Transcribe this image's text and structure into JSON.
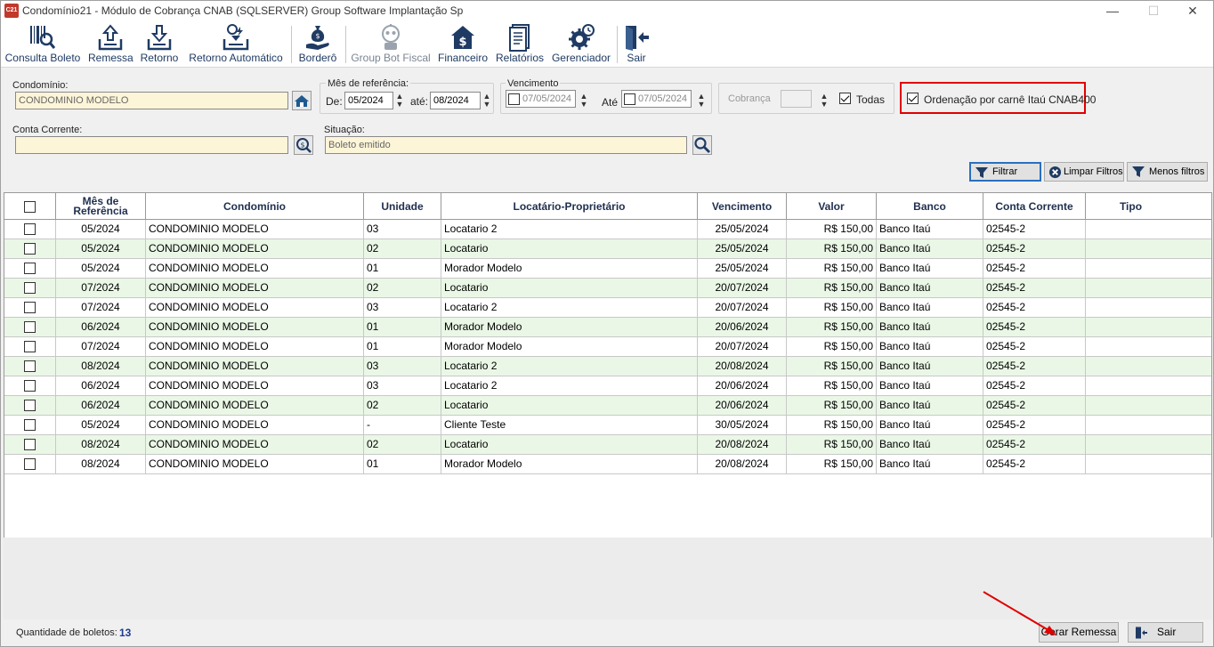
{
  "window": {
    "title": "Condomínio21 - Módulo de Cobrança CNAB (SQLSERVER)  Group Software Implantação Sp",
    "app_icon_text": "C21",
    "minimize": "—",
    "maximize": "☐",
    "close": "✕"
  },
  "toolbar": {
    "consulta_boleto": "Consulta Boleto",
    "remessa": "Remessa",
    "retorno": "Retorno",
    "retorno_automatico": "Retorno Automático",
    "bordero": "Borderô",
    "group_bot_fiscal": "Group Bot Fiscal",
    "financeiro": "Financeiro",
    "relatorios": "Relatórios",
    "gerenciador": "Gerenciador",
    "sair": "Sair"
  },
  "filters": {
    "condominio_label": "Condomínio:",
    "condominio_value": "CONDOMINIO MODELO",
    "mes_ref_label": "Mês de referência:",
    "de_label": "De:",
    "de_value": "05/2024",
    "ate_label": "até:",
    "ate_value": "08/2024",
    "vencimento_label": "Vencimento",
    "venc_de_value": "07/05/2024",
    "venc_ate_label": "Até",
    "venc_ate_value": "07/05/2024",
    "cobranca_label": "Cobrança",
    "todas_label": "Todas",
    "ordenacao_label": "Ordenação por carnê Itaú CNAB400",
    "conta_corrente_label": "Conta Corrente:",
    "conta_corrente_value": "",
    "situacao_label": "Situação:",
    "situacao_value": "Boleto emitido",
    "filtrar": "Filtrar",
    "limpar_filtros": "Limpar Filtros",
    "menos_filtros": "Menos filtros"
  },
  "table": {
    "headers": [
      "Mês de Referência",
      "Condomínio",
      "Unidade",
      "Locatário-Proprietário",
      "Vencimento",
      "Valor",
      "Banco",
      "Conta Corrente",
      "Tipo"
    ],
    "rows": [
      [
        "05/2024",
        "CONDOMINIO MODELO",
        "03",
        "Locatario 2",
        "25/05/2024",
        "R$ 150,00",
        "Banco Itaú",
        "02545-2",
        ""
      ],
      [
        "05/2024",
        "CONDOMINIO MODELO",
        "02",
        "Locatario",
        "25/05/2024",
        "R$ 150,00",
        "Banco Itaú",
        "02545-2",
        ""
      ],
      [
        "05/2024",
        "CONDOMINIO MODELO",
        "01",
        "Morador Modelo",
        "25/05/2024",
        "R$ 150,00",
        "Banco Itaú",
        "02545-2",
        ""
      ],
      [
        "07/2024",
        "CONDOMINIO MODELO",
        "02",
        "Locatario",
        "20/07/2024",
        "R$ 150,00",
        "Banco Itaú",
        "02545-2",
        ""
      ],
      [
        "07/2024",
        "CONDOMINIO MODELO",
        "03",
        "Locatario 2",
        "20/07/2024",
        "R$ 150,00",
        "Banco Itaú",
        "02545-2",
        ""
      ],
      [
        "06/2024",
        "CONDOMINIO MODELO",
        "01",
        "Morador Modelo",
        "20/06/2024",
        "R$ 150,00",
        "Banco Itaú",
        "02545-2",
        ""
      ],
      [
        "07/2024",
        "CONDOMINIO MODELO",
        "01",
        "Morador Modelo",
        "20/07/2024",
        "R$ 150,00",
        "Banco Itaú",
        "02545-2",
        ""
      ],
      [
        "08/2024",
        "CONDOMINIO MODELO",
        "03",
        "Locatario 2",
        "20/08/2024",
        "R$ 150,00",
        "Banco Itaú",
        "02545-2",
        ""
      ],
      [
        "06/2024",
        "CONDOMINIO MODELO",
        "03",
        "Locatario 2",
        "20/06/2024",
        "R$ 150,00",
        "Banco Itaú",
        "02545-2",
        ""
      ],
      [
        "06/2024",
        "CONDOMINIO MODELO",
        "02",
        "Locatario",
        "20/06/2024",
        "R$ 150,00",
        "Banco Itaú",
        "02545-2",
        ""
      ],
      [
        "05/2024",
        "CONDOMINIO MODELO",
        "-",
        "Cliente Teste",
        "30/05/2024",
        "R$ 150,00",
        "Banco Itaú",
        "02545-2",
        ""
      ],
      [
        "08/2024",
        "CONDOMINIO MODELO",
        "02",
        "Locatario",
        "20/08/2024",
        "R$ 150,00",
        "Banco Itaú",
        "02545-2",
        ""
      ],
      [
        "08/2024",
        "CONDOMINIO MODELO",
        "01",
        "Morador Modelo",
        "20/08/2024",
        "R$ 150,00",
        "Banco Itaú",
        "02545-2",
        ""
      ]
    ]
  },
  "footer": {
    "quantidade_label": "Quantidade de boletos:",
    "quantidade_value": "13",
    "gerar_remessa": "Gerar Remessa",
    "sair": "Sair"
  },
  "colors": {
    "row_alt": "#eaf7e6",
    "highlight": "#e00000",
    "input_bg": "#fdf5d8"
  }
}
